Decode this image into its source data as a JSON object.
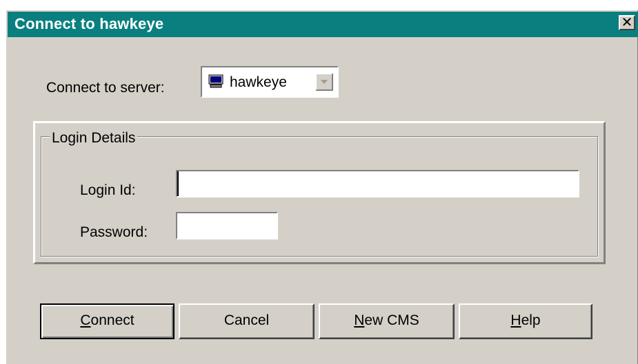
{
  "window": {
    "title": "Connect to hawkeye",
    "close_label": "×",
    "title_bar_color": "#0a7f7f",
    "face_color": "#d4d0c8"
  },
  "server": {
    "label": "Connect to server:",
    "selected": "hawkeye",
    "icon": "computer-icon"
  },
  "login_details": {
    "legend": "Login Details",
    "login_id_label": "Login Id:",
    "login_id_value": "",
    "password_label": "Password:",
    "password_value": ""
  },
  "buttons": {
    "connect": {
      "mnemonic": "C",
      "rest": "onnect"
    },
    "cancel": "Cancel",
    "new_cms": {
      "mnemonic": "N",
      "rest": "ew CMS"
    },
    "help": {
      "mnemonic": "H",
      "rest": "elp"
    }
  }
}
